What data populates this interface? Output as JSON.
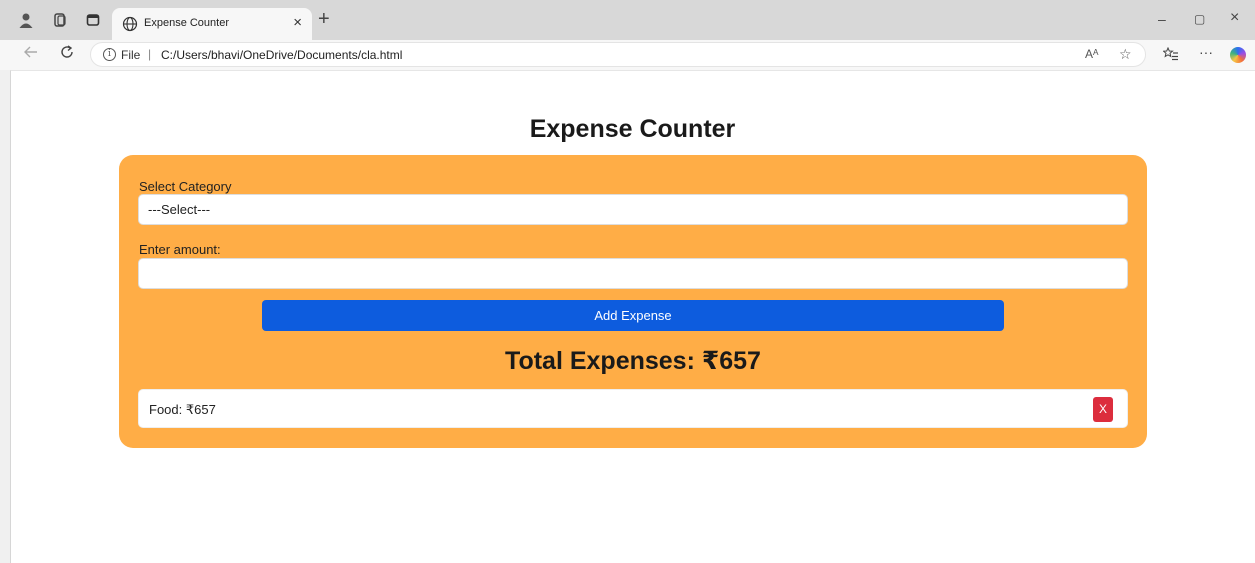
{
  "browser": {
    "tab_title": "Expense Counter",
    "tab_close": "×",
    "new_tab": "+",
    "file_label": "File",
    "separator": "|",
    "url": "C:/Users/bhavi/OneDrive/Documents/cla.html",
    "read_aloud": "Aᴬ",
    "window_controls": {
      "minimize": "–",
      "restore": "▢",
      "close": "×"
    },
    "more": "···"
  },
  "page": {
    "title": "Expense Counter",
    "category_label": "Select Category",
    "category_selected": "---Select---",
    "amount_label": "Enter amount:",
    "amount_value": "",
    "add_button_label": "Add Expense",
    "total_label": "Total Expenses: ₹657",
    "expenses": [
      {
        "text": "Food: ₹657",
        "delete_label": "X"
      }
    ]
  },
  "colors": {
    "card": "#ffad46",
    "primary_button": "#0d5cde",
    "delete_button": "#dc2d3d"
  },
  "icons": [
    "profile-icon",
    "workspaces-icon",
    "tab-actions-icon",
    "globe-icon",
    "back-arrow-icon",
    "refresh-icon",
    "info-icon",
    "favorite-star-icon",
    "favorites-list-icon",
    "copilot-icon"
  ]
}
